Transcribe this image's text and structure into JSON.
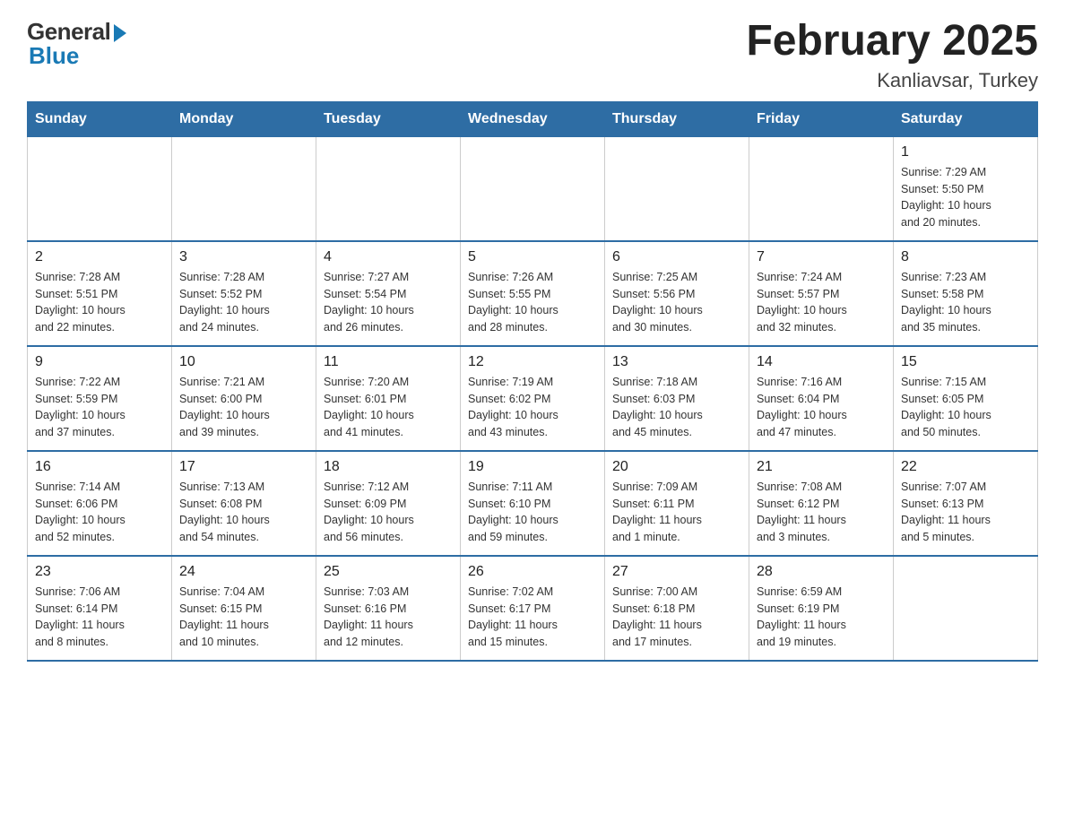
{
  "logo": {
    "general": "General",
    "blue": "Blue"
  },
  "title": "February 2025",
  "subtitle": "Kanliavsar, Turkey",
  "days_of_week": [
    "Sunday",
    "Monday",
    "Tuesday",
    "Wednesday",
    "Thursday",
    "Friday",
    "Saturday"
  ],
  "weeks": [
    {
      "days": [
        {
          "num": "",
          "info": ""
        },
        {
          "num": "",
          "info": ""
        },
        {
          "num": "",
          "info": ""
        },
        {
          "num": "",
          "info": ""
        },
        {
          "num": "",
          "info": ""
        },
        {
          "num": "",
          "info": ""
        },
        {
          "num": "1",
          "info": "Sunrise: 7:29 AM\nSunset: 5:50 PM\nDaylight: 10 hours\nand 20 minutes."
        }
      ]
    },
    {
      "days": [
        {
          "num": "2",
          "info": "Sunrise: 7:28 AM\nSunset: 5:51 PM\nDaylight: 10 hours\nand 22 minutes."
        },
        {
          "num": "3",
          "info": "Sunrise: 7:28 AM\nSunset: 5:52 PM\nDaylight: 10 hours\nand 24 minutes."
        },
        {
          "num": "4",
          "info": "Sunrise: 7:27 AM\nSunset: 5:54 PM\nDaylight: 10 hours\nand 26 minutes."
        },
        {
          "num": "5",
          "info": "Sunrise: 7:26 AM\nSunset: 5:55 PM\nDaylight: 10 hours\nand 28 minutes."
        },
        {
          "num": "6",
          "info": "Sunrise: 7:25 AM\nSunset: 5:56 PM\nDaylight: 10 hours\nand 30 minutes."
        },
        {
          "num": "7",
          "info": "Sunrise: 7:24 AM\nSunset: 5:57 PM\nDaylight: 10 hours\nand 32 minutes."
        },
        {
          "num": "8",
          "info": "Sunrise: 7:23 AM\nSunset: 5:58 PM\nDaylight: 10 hours\nand 35 minutes."
        }
      ]
    },
    {
      "days": [
        {
          "num": "9",
          "info": "Sunrise: 7:22 AM\nSunset: 5:59 PM\nDaylight: 10 hours\nand 37 minutes."
        },
        {
          "num": "10",
          "info": "Sunrise: 7:21 AM\nSunset: 6:00 PM\nDaylight: 10 hours\nand 39 minutes."
        },
        {
          "num": "11",
          "info": "Sunrise: 7:20 AM\nSunset: 6:01 PM\nDaylight: 10 hours\nand 41 minutes."
        },
        {
          "num": "12",
          "info": "Sunrise: 7:19 AM\nSunset: 6:02 PM\nDaylight: 10 hours\nand 43 minutes."
        },
        {
          "num": "13",
          "info": "Sunrise: 7:18 AM\nSunset: 6:03 PM\nDaylight: 10 hours\nand 45 minutes."
        },
        {
          "num": "14",
          "info": "Sunrise: 7:16 AM\nSunset: 6:04 PM\nDaylight: 10 hours\nand 47 minutes."
        },
        {
          "num": "15",
          "info": "Sunrise: 7:15 AM\nSunset: 6:05 PM\nDaylight: 10 hours\nand 50 minutes."
        }
      ]
    },
    {
      "days": [
        {
          "num": "16",
          "info": "Sunrise: 7:14 AM\nSunset: 6:06 PM\nDaylight: 10 hours\nand 52 minutes."
        },
        {
          "num": "17",
          "info": "Sunrise: 7:13 AM\nSunset: 6:08 PM\nDaylight: 10 hours\nand 54 minutes."
        },
        {
          "num": "18",
          "info": "Sunrise: 7:12 AM\nSunset: 6:09 PM\nDaylight: 10 hours\nand 56 minutes."
        },
        {
          "num": "19",
          "info": "Sunrise: 7:11 AM\nSunset: 6:10 PM\nDaylight: 10 hours\nand 59 minutes."
        },
        {
          "num": "20",
          "info": "Sunrise: 7:09 AM\nSunset: 6:11 PM\nDaylight: 11 hours\nand 1 minute."
        },
        {
          "num": "21",
          "info": "Sunrise: 7:08 AM\nSunset: 6:12 PM\nDaylight: 11 hours\nand 3 minutes."
        },
        {
          "num": "22",
          "info": "Sunrise: 7:07 AM\nSunset: 6:13 PM\nDaylight: 11 hours\nand 5 minutes."
        }
      ]
    },
    {
      "days": [
        {
          "num": "23",
          "info": "Sunrise: 7:06 AM\nSunset: 6:14 PM\nDaylight: 11 hours\nand 8 minutes."
        },
        {
          "num": "24",
          "info": "Sunrise: 7:04 AM\nSunset: 6:15 PM\nDaylight: 11 hours\nand 10 minutes."
        },
        {
          "num": "25",
          "info": "Sunrise: 7:03 AM\nSunset: 6:16 PM\nDaylight: 11 hours\nand 12 minutes."
        },
        {
          "num": "26",
          "info": "Sunrise: 7:02 AM\nSunset: 6:17 PM\nDaylight: 11 hours\nand 15 minutes."
        },
        {
          "num": "27",
          "info": "Sunrise: 7:00 AM\nSunset: 6:18 PM\nDaylight: 11 hours\nand 17 minutes."
        },
        {
          "num": "28",
          "info": "Sunrise: 6:59 AM\nSunset: 6:19 PM\nDaylight: 11 hours\nand 19 minutes."
        },
        {
          "num": "",
          "info": ""
        }
      ]
    }
  ]
}
